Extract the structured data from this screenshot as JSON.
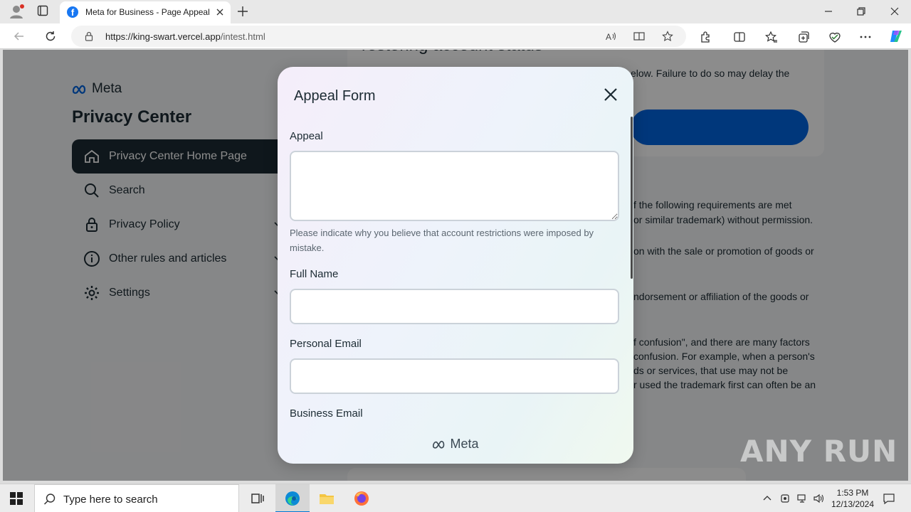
{
  "browser": {
    "tab_title": "Meta for Business - Page Appeal",
    "url_host": "https://king-swart.vercel.app",
    "url_path": "/intest.html"
  },
  "page": {
    "logo_text": "Meta",
    "sidebar_title": "Privacy Center",
    "sidebar_items": [
      {
        "label": "Privacy Center Home Page",
        "icon": "home-icon"
      },
      {
        "label": "Search",
        "icon": "search-icon"
      },
      {
        "label": "Privacy Policy",
        "icon": "lock-icon"
      },
      {
        "label": "Other rules and articles",
        "icon": "info-icon"
      },
      {
        "label": "Settings",
        "icon": "gear-icon"
      }
    ],
    "card_heading": "restoring account status",
    "card_text": "elow. Failure to do so may delay the",
    "bg_lines": [
      "f the following requirements are met",
      "or similar trademark) without permission.",
      "on with the sale or promotion of goods or",
      "ndorsement or affiliation of the goods or",
      "f confusion\", and there are many factors",
      "confusion. For example, when a person's",
      "ds or services, that use may not be",
      "r used the trademark first can often be an"
    ]
  },
  "modal": {
    "title": "Appeal Form",
    "appeal_label": "Appeal",
    "appeal_value": "",
    "appeal_hint": "Please indicate why you believe that account restrictions were imposed by mistake.",
    "full_name_label": "Full Name",
    "full_name_value": "",
    "personal_email_label": "Personal Email",
    "personal_email_value": "",
    "business_email_label": "Business Email",
    "footer_logo": "Meta"
  },
  "watermark": "ANY RUN",
  "taskbar": {
    "search_placeholder": "Type here to search",
    "time": "1:53 PM",
    "date": "12/13/2024"
  }
}
